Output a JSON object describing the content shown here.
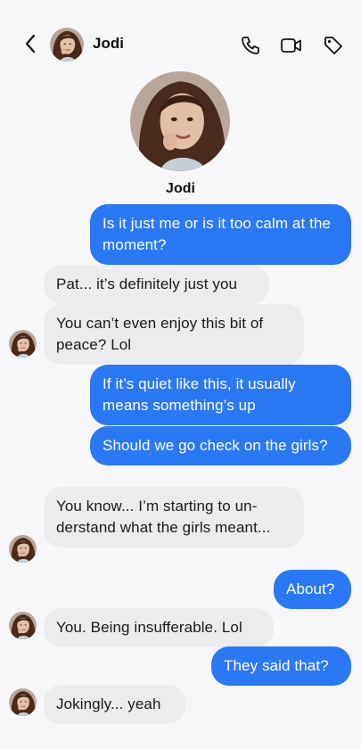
{
  "header": {
    "back_icon": "chevron-left-icon",
    "contact_name": "Jodi",
    "icons": [
      "phone-icon",
      "video-icon",
      "tag-icon"
    ]
  },
  "profile": {
    "name": "Jodi"
  },
  "colors": {
    "outgoing": "#2a78f4",
    "incoming": "#ececee",
    "background": "#f7f7f9"
  },
  "messages": [
    {
      "from": "me",
      "text": "Is it just me or is it too calm at the moment?"
    },
    {
      "from": "jodi",
      "text": "Pat... it’s definitely just you"
    },
    {
      "from": "jodi",
      "text": "You can’t even enjoy this bit of peace? Lol"
    },
    {
      "from": "me",
      "text": "If it’s quiet like this, it usually means something’s up"
    },
    {
      "from": "me",
      "text": "Should we go check on the girls?"
    },
    {
      "from": "jodi",
      "text": "You know... I’m starting to un- derstand what the girls meant..."
    },
    {
      "from": "me",
      "text": "About?"
    },
    {
      "from": "jodi",
      "text": "You. Being insufferable. Lol"
    },
    {
      "from": "me",
      "text": "They said that?"
    },
    {
      "from": "jodi",
      "text": "Jokingly... yeah"
    }
  ]
}
